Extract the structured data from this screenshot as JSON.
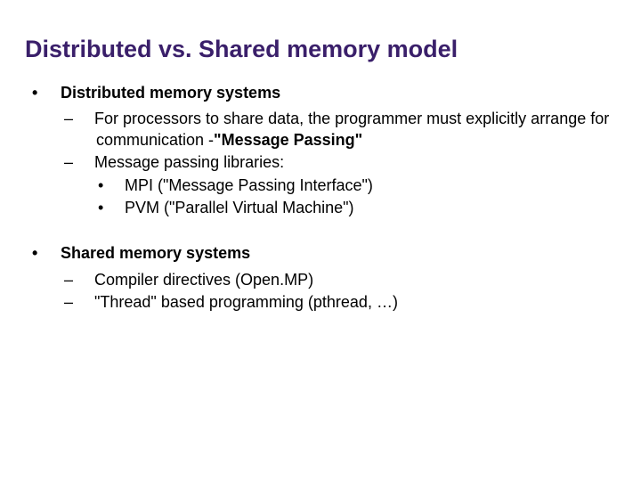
{
  "title": "Distributed vs. Shared memory model",
  "b1": {
    "head": "Distributed memory systems",
    "p1a": "For processors to share data, the programmer must explicitly arrange for communication -",
    "p1b": "\"Message Passing\"",
    "p2": "Message passing libraries:",
    "s1": "MPI (\"Message Passing Interface\")",
    "s2": "PVM (\"Parallel Virtual Machine\")"
  },
  "b2": {
    "head": "Shared memory systems",
    "p1": "Compiler directives (Open.MP)",
    "p2": "\"Thread\" based programming (pthread, …)"
  }
}
